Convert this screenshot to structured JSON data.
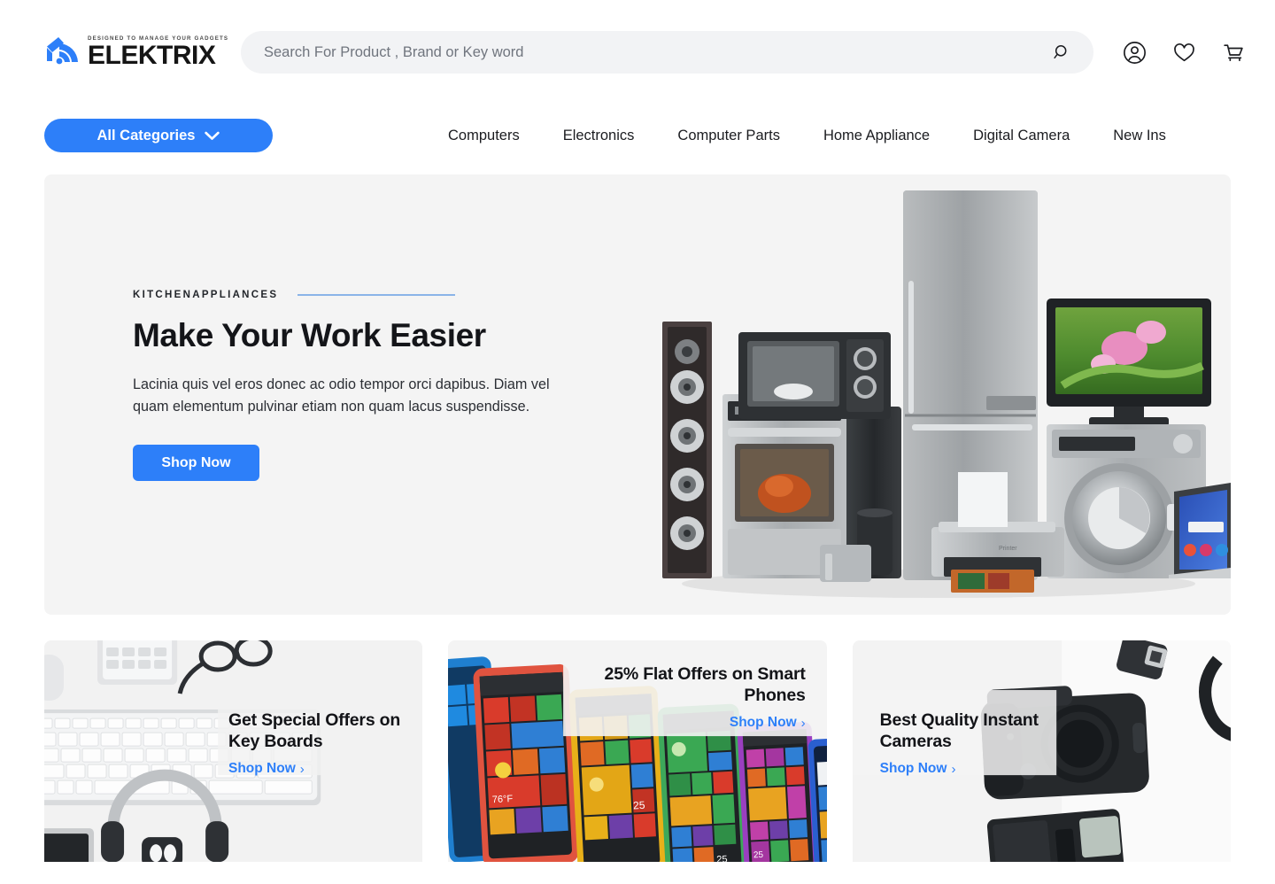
{
  "brand": {
    "tagline": "DESIGNED TO MANAGE YOUR GADGETS",
    "name": "ELEKTRIX",
    "logo_color": "#2d7ff9"
  },
  "search": {
    "placeholder": "Search For Product , Brand or Key word",
    "value": "",
    "icon": "search-icon"
  },
  "header_icons": [
    {
      "name": "account-icon",
      "label": "Account"
    },
    {
      "name": "wishlist-heart-icon",
      "label": "Wishlist"
    },
    {
      "name": "cart-icon",
      "label": "Cart"
    }
  ],
  "nav": {
    "all_categories_label": "All Categories",
    "all_categories_icon": "chevron-down-icon",
    "accent_color": "#2d7ff9",
    "links": [
      {
        "label": "Computers"
      },
      {
        "label": "Electronics"
      },
      {
        "label": "Computer Parts"
      },
      {
        "label": "Home Appliance"
      },
      {
        "label": "Digital Camera"
      },
      {
        "label": "New Ins"
      }
    ]
  },
  "hero": {
    "eyebrow": "KITCHENAPPLIANCES",
    "title": "Make Your Work Easier",
    "description": "Lacinia quis vel eros donec ac odio tempor orci dapibus. Diam vel quam elementum pulvinar etiam non quam lacus suspendisse.",
    "cta_label": "Shop Now",
    "background": "#f4f4f4",
    "art_alt": "home-appliances-collage"
  },
  "promo_cards": [
    {
      "title": "Get Special Offers on Key Boards",
      "link_label": "Shop Now",
      "link_icon": "chevron-right-icon",
      "art_alt": "keyboard-desk-flatlay"
    },
    {
      "title": "25% Flat Offers on Smart Phones",
      "link_label": "Shop Now",
      "link_icon": "chevron-right-icon",
      "art_alt": "colorful-smartphones-row"
    },
    {
      "title": "Best Quality Instant Cameras",
      "link_label": "Shop Now",
      "link_icon": "chevron-right-icon",
      "art_alt": "dslr-camera-flatlay"
    }
  ]
}
